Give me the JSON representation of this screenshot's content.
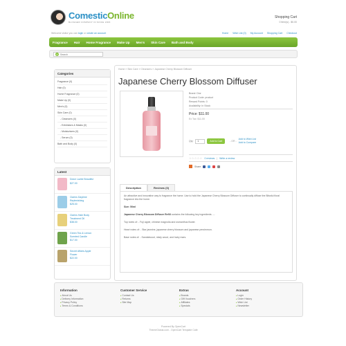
{
  "header": {
    "logo_name_1": "Comestic",
    "logo_name_2": "Online",
    "tagline": "BLOGGER COMPANY IN SINCE 2006",
    "cart_title": "Shopping Cart",
    "cart_items": "0 item(s) - $0.00",
    "welcome_prefix": "Welcome visitor you can",
    "welcome_login": "login",
    "welcome_or": "or",
    "welcome_create": "create an account",
    "toplinks": [
      "Home",
      "Wish List (0)",
      "My Account",
      "Shopping Cart",
      "Checkout"
    ]
  },
  "menu": [
    "Fragrance",
    "Hair",
    "Home Fragrance",
    "Make Up",
    "Men's",
    "Skin Care",
    "Bath and Body"
  ],
  "search": {
    "placeholder": "Search"
  },
  "categories": {
    "title": "Categories",
    "items": [
      {
        "label": "Fragrance (0)",
        "sub": false
      },
      {
        "label": "Hair (0)",
        "sub": false
      },
      {
        "label": "Home Fragrance (0)",
        "sub": false
      },
      {
        "label": "Make Up (0)",
        "sub": false
      },
      {
        "label": "Men's (0)",
        "sub": false
      },
      {
        "label": "Skin Care (0)",
        "sub": false
      },
      {
        "label": "- Cleansers (0)",
        "sub": true
      },
      {
        "label": "- Exfoliators & Masks (0)",
        "sub": true
      },
      {
        "label": "- Moisturisers (0)",
        "sub": true
      },
      {
        "label": "- Serum (0)",
        "sub": true
      },
      {
        "label": "Bath and Body (0)",
        "sub": false
      }
    ]
  },
  "latest": {
    "title": "Latest",
    "items": [
      {
        "name": "Dolce Lavbe Beautiful",
        "price": "$27.00",
        "color": "#f2b9c7"
      },
      {
        "name": "Clarins Daytime Replenishing",
        "price": "$25.00",
        "color": "#9ccde8"
      },
      {
        "name": "Clarins Hale Body Treatment Oil",
        "price": "$38.00",
        "color": "#e7d07a"
      },
      {
        "name": "Green Tea & Lemon Scented Candle",
        "price": "$17.00",
        "color": "#6fa34b"
      },
      {
        "name": "Secret Affairs Apple Flower",
        "price": "$22.00",
        "color": "#b9a36b"
      }
    ]
  },
  "product": {
    "breadcrumb": "Home » Skin Care » Cleansers » Japanese Cherry Blossom Diffuser",
    "title": "Japanese Cherry Blossom Diffuser",
    "brand": "Brand: Dior",
    "code": "Product Code: product",
    "reward": "Reward Points: 0",
    "availability": "Availability: In Stock",
    "price": "Price: $11.00",
    "ex_tax": "Ex Tax: $11.00",
    "qty_label": "Qty:",
    "qty_value": "1",
    "add_to_cart": "Add to Cart",
    "or": "- OR -",
    "wishlist": "Add to Wish List",
    "compare": "Add to Compare",
    "reviews_link": "0 reviews",
    "write_review": "Write a review",
    "share": "Share",
    "stars": "☆☆☆☆☆",
    "tabs": [
      "Description",
      "Reviews (0)"
    ],
    "desc": {
      "p1": "An attractive and innovative way to fragrance the home. Use to hold the Japanese Cherry Blossom Diffuser to continually diffuse the Blissful floral fragrance into the home.",
      "size": "Size: 50ml",
      "p2_bold": "Japanese Cherry Blossom Diffuser Refill",
      "p2": "contains the following key ingredients ....",
      "top": "Top notes of: - Fuji apple, chinese magnolia and osmanthus flower.",
      "heart": "Heart notes of: - Star jasmine, japanese cherry blossom and japanese persimmon.",
      "base": "Base notes of: - Sandalwood, misty wood, and hairy mars."
    }
  },
  "footer": {
    "columns": [
      {
        "title": "Information",
        "links": [
          "About Us",
          "Delivery Information",
          "Privacy Policy",
          "Terms & Conditions"
        ]
      },
      {
        "title": "Customer Service",
        "links": [
          "Contact Us",
          "Returns",
          "Site Map"
        ]
      },
      {
        "title": "Extras",
        "links": [
          "Brands",
          "Gift Vouchers",
          "Affiliates",
          "Specials"
        ]
      },
      {
        "title": "Account",
        "links": [
          "Login",
          "Order History",
          "Wish List",
          "Newsletter"
        ]
      }
    ],
    "powered_1": "Powered By OpenCart",
    "powered_2": "ThemeGlobal.com - OpenCart Template Cafe"
  }
}
